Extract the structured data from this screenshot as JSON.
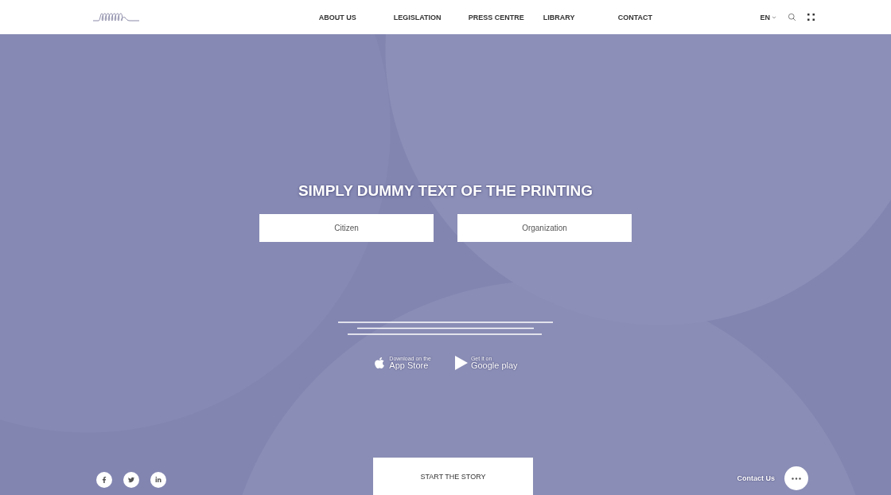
{
  "header": {
    "nav": [
      "ABOUT US",
      "LEGISLATION",
      "PRESS CENTRE",
      "LIBRARY",
      "CONTACT"
    ],
    "language": "EN"
  },
  "hero": {
    "title": "SIMPLY DUMMY TEXT OF THE PRINTING",
    "choices": [
      "Citizen",
      "Organization"
    ],
    "stores": [
      {
        "kind": "apple",
        "small": "Download on the",
        "big": "App Store"
      },
      {
        "kind": "google",
        "small": "Get it on",
        "big": "Google play"
      }
    ]
  },
  "footer": {
    "socials": [
      {
        "kind": "facebook"
      },
      {
        "kind": "twitter"
      },
      {
        "kind": "linkedin"
      }
    ],
    "start_button": "START THE STORY",
    "contact": "Contact Us"
  }
}
